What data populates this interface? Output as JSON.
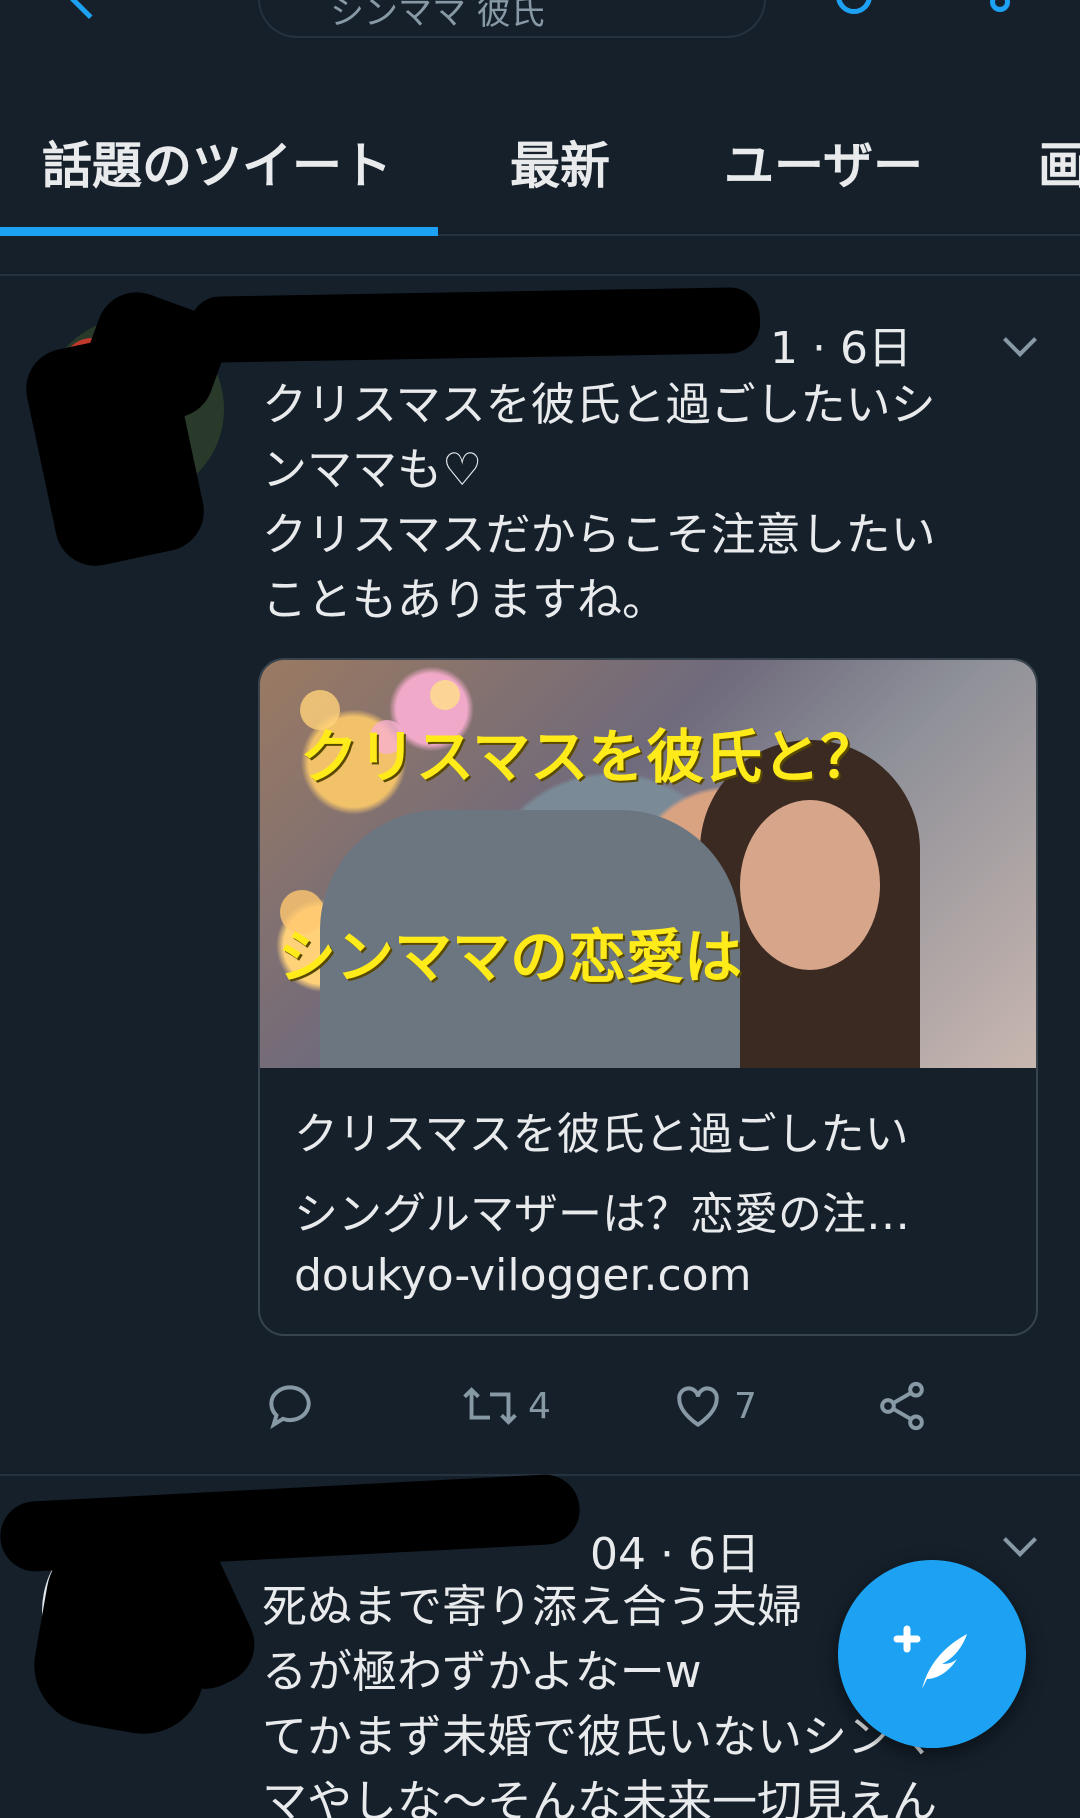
{
  "search": {
    "query": "シンママ 彼氏"
  },
  "tabs": [
    {
      "label": "話題のツイート",
      "active": true
    },
    {
      "label": "最新"
    },
    {
      "label": "ユーザー"
    },
    {
      "label": "画"
    }
  ],
  "tweets": [
    {
      "handle_tail": "1",
      "time": "6日",
      "text": "クリスマスを彼氏と過ごしたいシ\nンママも♡\nクリスマスだからこそ注意したい\nこともありますね。",
      "card": {
        "image_caption_1": "クリスマスを彼氏と？",
        "image_caption_2": "シンママの恋愛は",
        "title_line_1": "クリスマスを彼氏と過ごしたい",
        "title_line_2": "シングルマザーは？恋愛の注…",
        "domain": "doukyo-vilogger.com"
      },
      "retweets": "4",
      "likes": "7"
    },
    {
      "handle_tail": "04",
      "time": "6日",
      "text": "死ぬまで寄り添え合う夫婦\nるが極わずかよなーw\nてかまず未婚で彼氏いないシンマ\nマやしな〜そんな未来一切見えん"
    }
  ],
  "colors": {
    "background": "#15202b",
    "accent": "#1da1f2",
    "muted": "#8899a6",
    "border": "#253341"
  },
  "icons": [
    "back-arrow-icon",
    "search-icon",
    "more-icon",
    "chevron-down-icon",
    "reply-icon",
    "retweet-icon",
    "like-icon",
    "share-icon",
    "compose-icon"
  ]
}
